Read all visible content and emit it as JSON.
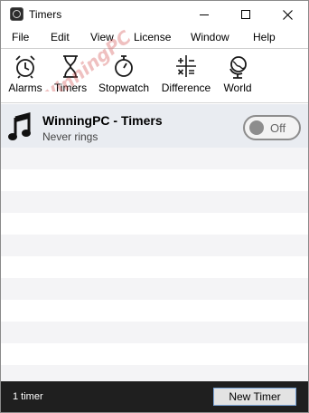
{
  "window": {
    "title": "Timers",
    "icons": {
      "app": "timers-app-icon",
      "minimize": "minimize-icon",
      "maximize": "maximize-icon",
      "close": "close-icon"
    }
  },
  "menu": {
    "items": [
      "File",
      "Edit",
      "View",
      "License",
      "Window",
      "Help"
    ]
  },
  "toolbar": {
    "items": [
      {
        "label": "Alarms",
        "icon": "alarm-clock-icon"
      },
      {
        "label": "Timers",
        "icon": "hourglass-icon"
      },
      {
        "label": "Stopwatch",
        "icon": "stopwatch-icon"
      },
      {
        "label": "Difference",
        "icon": "calculator-icon"
      },
      {
        "label": "World",
        "icon": "globe-icon"
      }
    ]
  },
  "timers": [
    {
      "name": "WinningPC - Timers",
      "subtitle": "Never rings",
      "icon": "music-note-icon",
      "toggle_label": "Off",
      "enabled": false
    }
  ],
  "status": {
    "count_text": "1 timer",
    "new_button_label": "New Timer"
  },
  "watermark": {
    "text": "WinningPC",
    "color": "#d24a4a"
  },
  "colors": {
    "selected_row": "#e9ecf1",
    "stripe": "#f4f4f6",
    "status_bar": "#1f1f1f",
    "toggle": "#8d8d8d",
    "button_border": "#7aa3d6"
  }
}
